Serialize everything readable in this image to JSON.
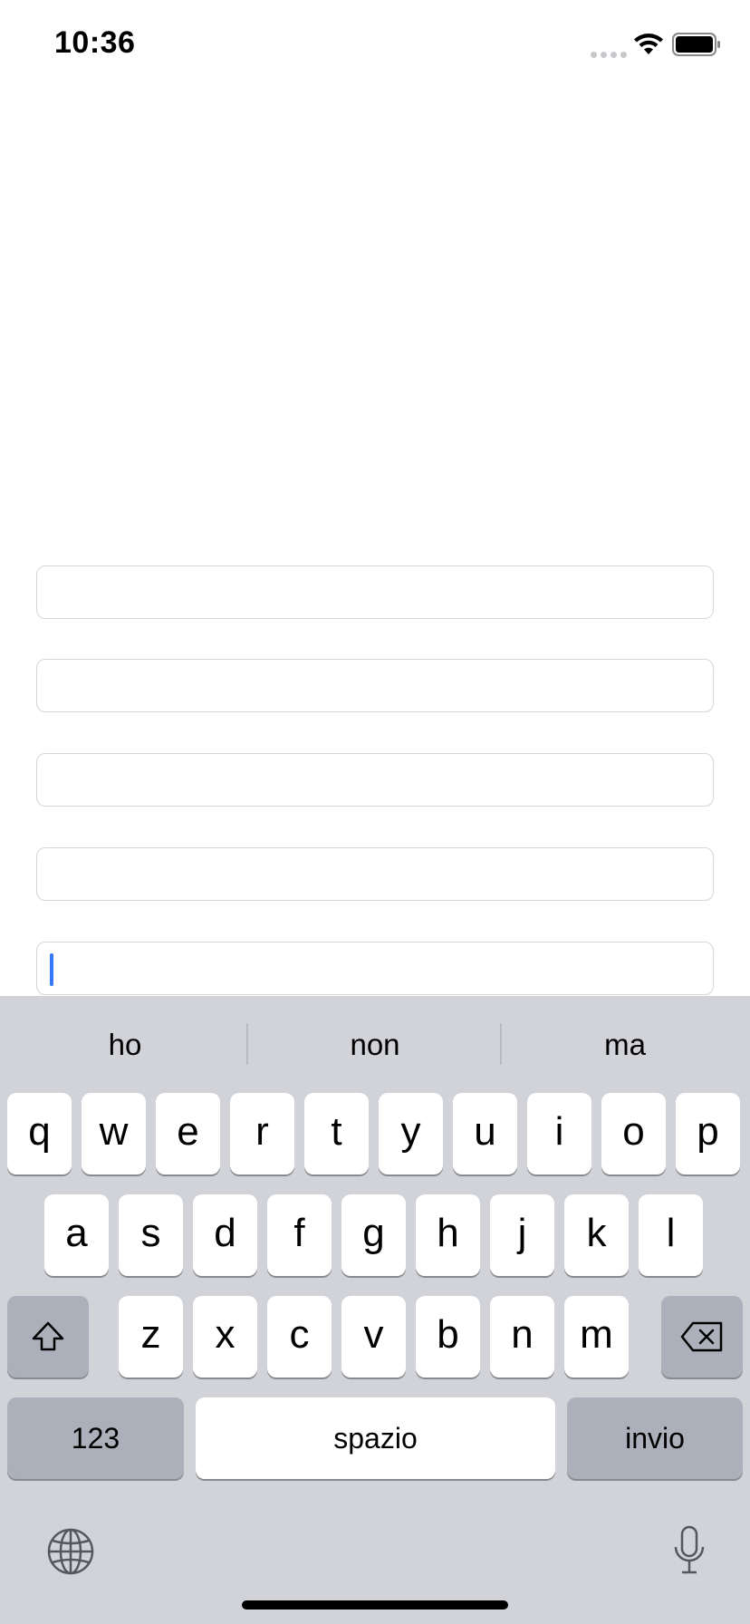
{
  "status_bar": {
    "time": "10:36"
  },
  "fields": [
    {
      "value": "",
      "placeholder": ""
    },
    {
      "value": "",
      "placeholder": ""
    },
    {
      "value": "",
      "placeholder": ""
    },
    {
      "value": "",
      "placeholder": ""
    },
    {
      "value": "",
      "placeholder": "",
      "focused": true
    }
  ],
  "keyboard": {
    "suggestions": [
      "ho",
      "non",
      "ma"
    ],
    "row1": [
      "q",
      "w",
      "e",
      "r",
      "t",
      "y",
      "u",
      "i",
      "o",
      "p"
    ],
    "row2": [
      "a",
      "s",
      "d",
      "f",
      "g",
      "h",
      "j",
      "k",
      "l"
    ],
    "row3": [
      "z",
      "x",
      "c",
      "v",
      "b",
      "n",
      "m"
    ],
    "numbers_label": "123",
    "space_label": "spazio",
    "return_label": "invio",
    "icons": [
      "shift-icon",
      "delete-icon",
      "globe-icon",
      "microphone-icon"
    ]
  },
  "colors": {
    "caret": "#3478f6",
    "keyboard_bg": "#d1d3d9",
    "dark_key": "#abb0ba"
  }
}
